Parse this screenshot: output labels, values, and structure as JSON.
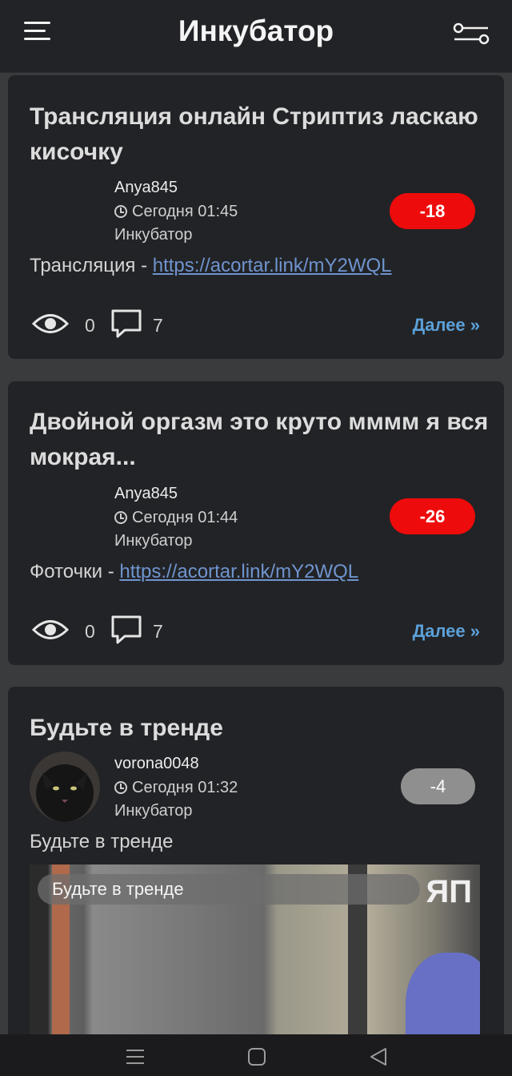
{
  "header": {
    "title": "Инкубатор",
    "menu_icon": "hamburger-menu-icon",
    "filter_icon": "filter-sliders-icon"
  },
  "posts": [
    {
      "title": "Трансляция онлайн Стриптиз ласкаю кисочку",
      "author": "Anya845",
      "time": "Сегодня 01:45",
      "community": "Инкубатор",
      "rating": "-18",
      "rating_color": "#ee0b0b",
      "body_prefix": "Трансляция - ",
      "link": "https://acortar.link/mY2WQL",
      "views": "0",
      "comments": "7",
      "more": "Далее »"
    },
    {
      "title": "Двойной оргазм это круто мммм я вся мокрая...",
      "author": "Anya845",
      "time": "Сегодня 01:44",
      "community": "Инкубатор",
      "rating": "-26",
      "rating_color": "#ee0b0b",
      "body_prefix": "Фоточки - ",
      "link": "https://acortar.link/mY2WQL",
      "views": "0",
      "comments": "7",
      "more": "Далее »"
    },
    {
      "title": "Будьте в тренде",
      "author": "vorona0048",
      "time": "Сегодня 01:32",
      "community": "Инкубатор",
      "rating": "-4",
      "rating_color": "#8f8f8f",
      "body_text": "Будьте в тренде",
      "video_caption": "Будьте в тренде",
      "video_logo": "ЯП"
    }
  ],
  "navbar": {
    "icons": [
      "recent-apps-icon",
      "home-icon",
      "back-icon"
    ]
  }
}
